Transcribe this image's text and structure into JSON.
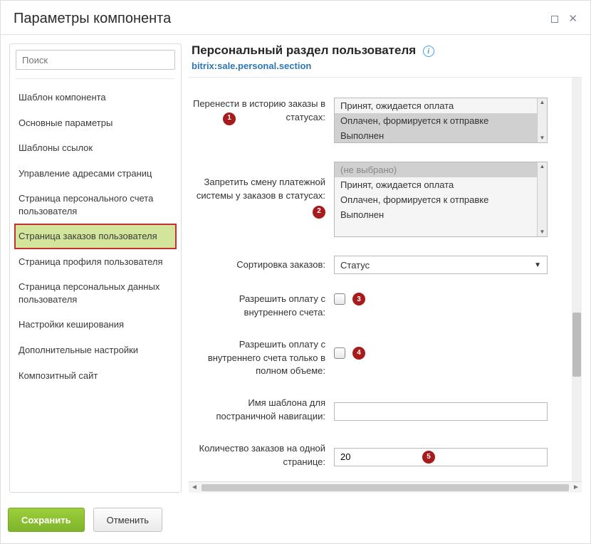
{
  "dialog": {
    "title": "Параметры компонента"
  },
  "search": {
    "placeholder": "Поиск"
  },
  "sidebar": {
    "items": [
      {
        "label": "Шаблон компонента"
      },
      {
        "label": "Основные параметры"
      },
      {
        "label": "Шаблоны ссылок"
      },
      {
        "label": "Управление адресами страниц"
      },
      {
        "label": "Страница персонального счета пользователя"
      },
      {
        "label": "Страница заказов пользователя"
      },
      {
        "label": "Страница профиля пользователя"
      },
      {
        "label": "Страница персональных данных пользователя"
      },
      {
        "label": "Настройки кеширования"
      },
      {
        "label": "Дополнительные настройки"
      },
      {
        "label": "Композитный сайт"
      }
    ],
    "active_index": 5
  },
  "main": {
    "title": "Персональный раздел пользователя",
    "component_code": "bitrix:sale.personal.section",
    "info_glyph": "i"
  },
  "params": {
    "history_status": {
      "label": "Перенести в историю заказы в статусах:",
      "options": [
        "Принят, ожидается оплата",
        "Оплачен, формируется к отправке",
        "Выполнен"
      ],
      "selected": [
        1,
        2
      ],
      "marker": "1"
    },
    "restrict_paysys": {
      "label": "Запретить смену платежной системы у заказов в статусах:",
      "options": [
        "(не выбрано)",
        "Принят, ожидается оплата",
        "Оплачен, формируется к отправке",
        "Выполнен"
      ],
      "selected": [
        0
      ],
      "marker": "2"
    },
    "sort_orders": {
      "label": "Сортировка заказов:",
      "value": "Статус"
    },
    "allow_inner_pay": {
      "label": "Разрешить оплату с внутреннего счета:",
      "checked": false,
      "marker": "3"
    },
    "allow_inner_full": {
      "label": "Разрешить оплату с внутреннего счета только в полном объеме:",
      "checked": false,
      "marker": "4"
    },
    "nav_template": {
      "label": "Имя шаблона для постраничной навигации:",
      "value": ""
    },
    "per_page": {
      "label": "Количество заказов на одной странице:",
      "value": "20",
      "marker": "5"
    }
  },
  "footer": {
    "save": "Сохранить",
    "cancel": "Отменить"
  }
}
